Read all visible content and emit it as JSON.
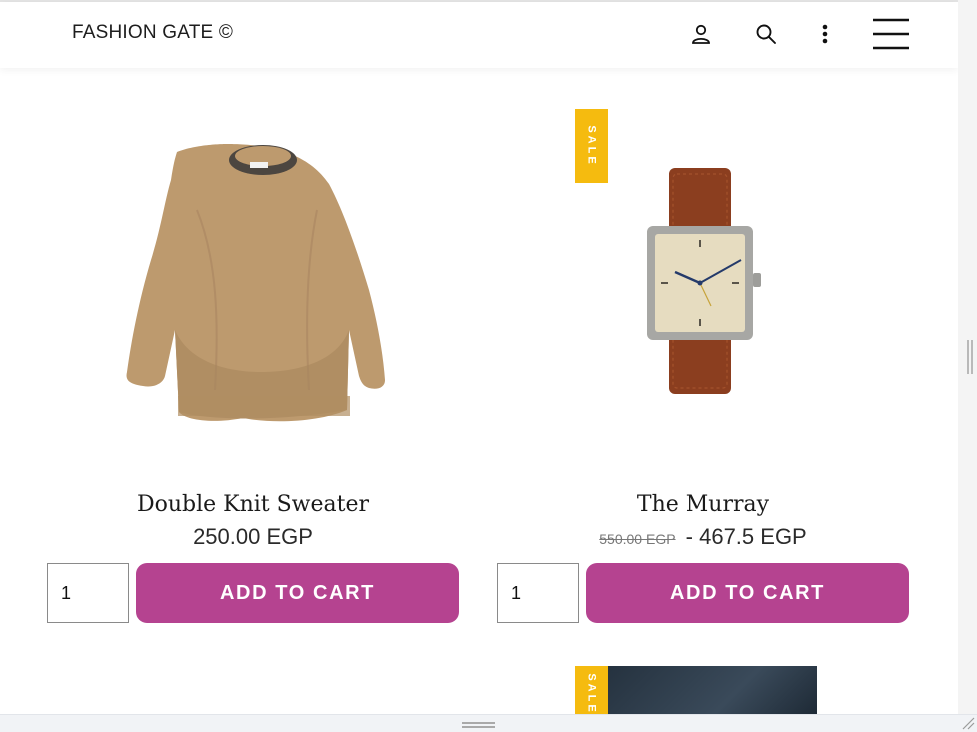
{
  "header": {
    "brand": "FASHION GATE ©",
    "icons": [
      "account-icon",
      "search-icon",
      "more-vertical-icon",
      "hamburger-menu-icon"
    ]
  },
  "products": [
    {
      "name": "Double Knit Sweater",
      "price": "250.00 EGP",
      "quantity": "1",
      "add_to_cart": "ADD TO CART",
      "on_sale": false
    },
    {
      "name": "The Murray",
      "old_price": "550.00 EGP",
      "price": " - 467.5 EGP",
      "quantity": "1",
      "add_to_cart": "ADD TO CART",
      "on_sale": true,
      "sale_label": "SALE"
    }
  ],
  "next_row": {
    "sale_label": "SALE"
  },
  "colors": {
    "accent": "#b54390",
    "sale_badge": "#f5bb0f"
  }
}
